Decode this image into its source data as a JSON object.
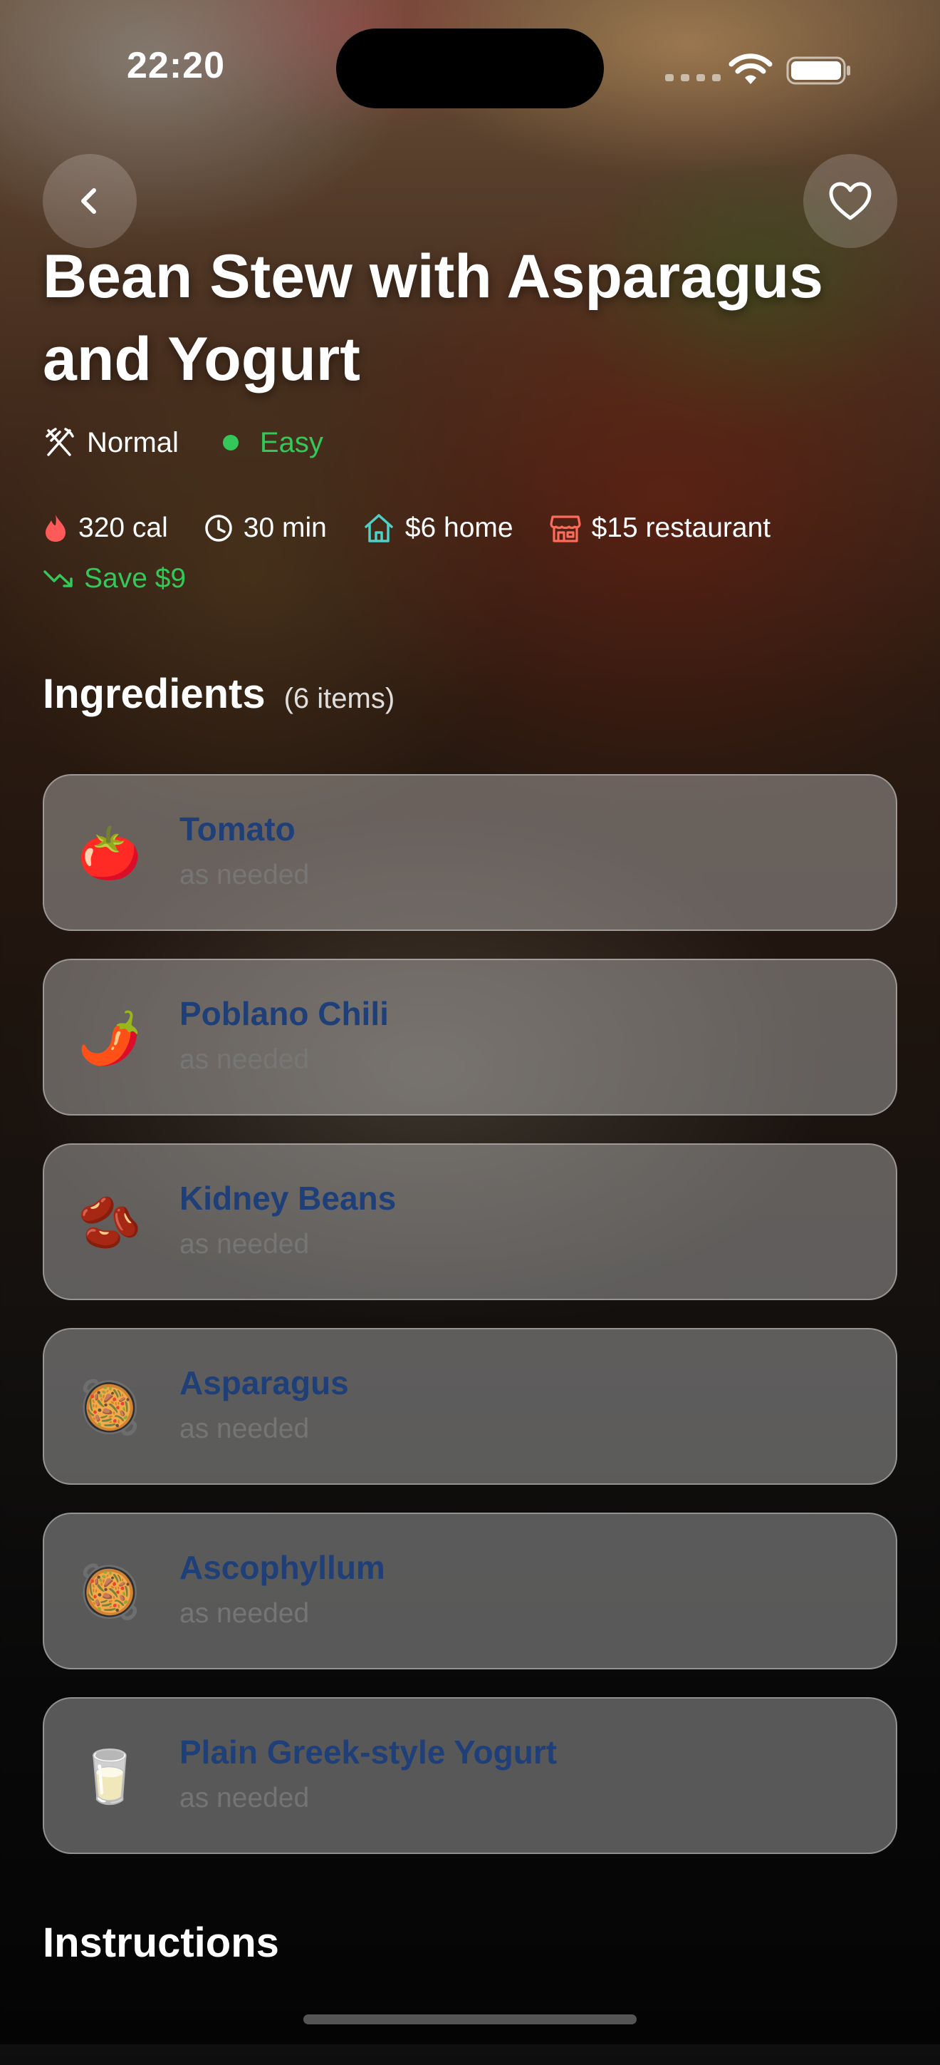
{
  "status_bar": {
    "time": "22:20"
  },
  "recipe": {
    "title": "Bean Stew with Asparagus and Yogurt",
    "portion": "Normal",
    "difficulty": "Easy",
    "calories": "320 cal",
    "time": "30 min",
    "home_cost": "$6 home",
    "restaurant_cost": "$15 restaurant",
    "savings": "Save $9"
  },
  "ingredients": {
    "title": "Ingredients",
    "count": "(6 items)",
    "items": [
      {
        "emoji": "🍅",
        "name": "Tomato",
        "qty": "as needed"
      },
      {
        "emoji": "🌶️",
        "name": "Poblano Chili",
        "qty": "as needed"
      },
      {
        "emoji": "🫘",
        "name": "Kidney Beans",
        "qty": "as needed"
      },
      {
        "emoji": "🥘",
        "name": "Asparagus",
        "qty": "as needed"
      },
      {
        "emoji": "🥘",
        "name": "Ascophyllum",
        "qty": "as needed"
      },
      {
        "emoji": "🥛",
        "name": "Plain Greek-style Yogurt",
        "qty": "as needed"
      }
    ]
  },
  "instructions": {
    "title": "Instructions"
  },
  "colors": {
    "accent_green": "#34c759",
    "ingredient_name": "#1f3f78",
    "calorie_icon": "#ff5a5a",
    "home_icon": "#4fd1c5",
    "restaurant_icon": "#ff6b5a"
  },
  "icons": {
    "back": "chevron-left-icon",
    "favorite": "heart-icon",
    "portion": "utensils-icon",
    "calories": "flame-icon",
    "time": "clock-icon",
    "home": "house-icon",
    "restaurant": "storefront-icon",
    "savings": "trend-down-icon"
  }
}
